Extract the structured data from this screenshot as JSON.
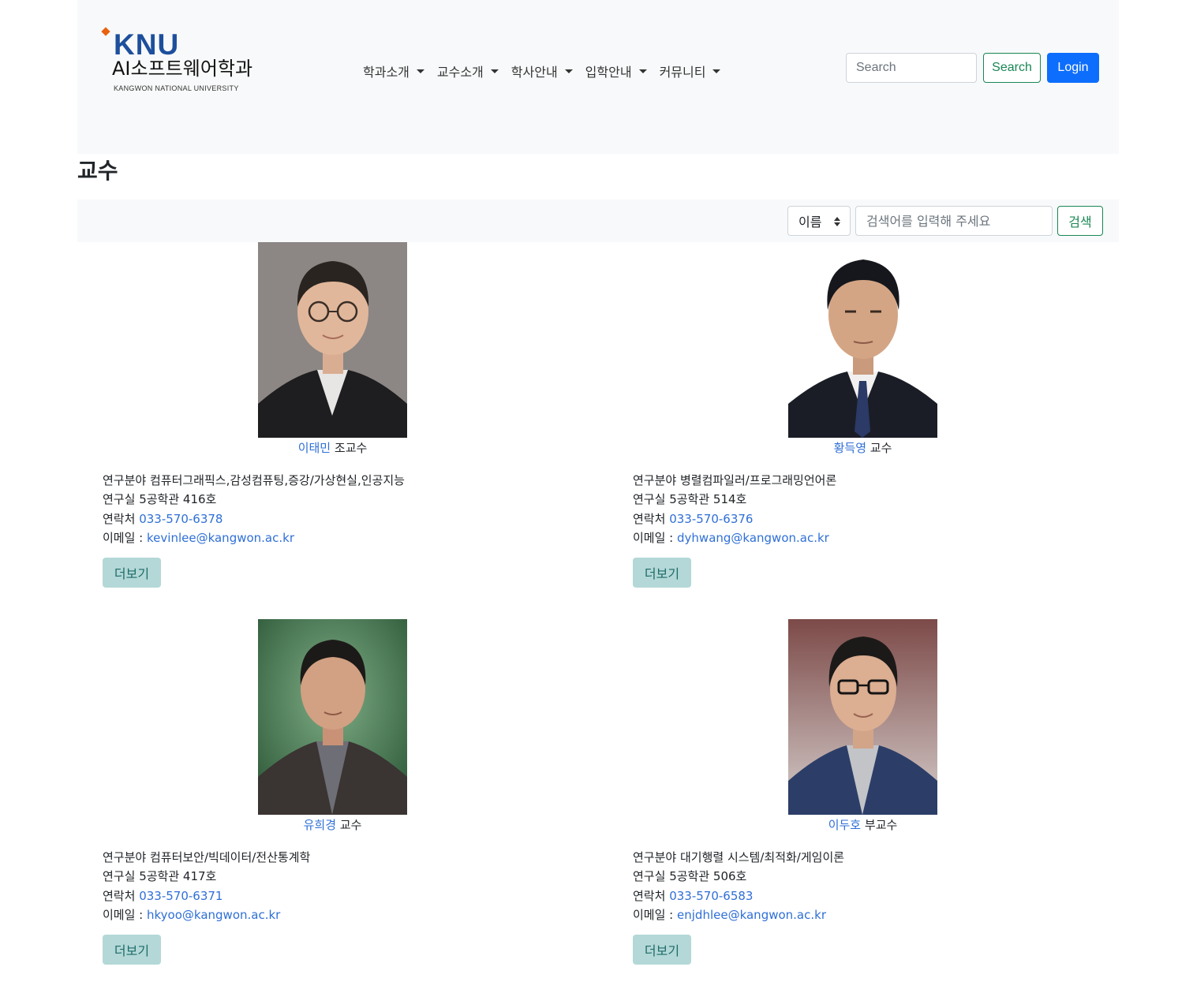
{
  "header": {
    "logo": {
      "brand": "KNU",
      "dept": "AI소프트웨어학과",
      "univ": "KANGWON NATIONAL UNIVERSITY",
      "brand_color": "#1d4f9c",
      "accent_color": "#e8620f"
    },
    "nav": [
      "학과소개",
      "교수소개",
      "학사안내",
      "입학안내",
      "커뮤니티"
    ],
    "search_placeholder": "Search",
    "search_button": "Search",
    "login_button": "Login"
  },
  "page": {
    "title": "교수"
  },
  "filter": {
    "select_value": "이름",
    "input_placeholder": "검색어를 입력해 주세요",
    "button": "검색"
  },
  "labels": {
    "field": "연구분야",
    "office": "연구실",
    "contact": "연락처",
    "email": "이메일 :",
    "more": "더보기"
  },
  "professors": [
    {
      "name": "이태민",
      "rank": "조교수",
      "field": "컴퓨터그래픽스,감성컴퓨팅,증강/가상현실,인공지능",
      "office": "5공학관 416호",
      "phone": "033-570-6378",
      "email": "kevinlee@kangwon.ac.kr",
      "photo_bg": "#8c8784"
    },
    {
      "name": "황득영",
      "rank": "교수",
      "field": "병렬컴파일러/프로그래밍언어론",
      "office": "5공학관 514호",
      "phone": "033-570-6376",
      "email": "dyhwang@kangwon.ac.kr",
      "photo_bg": "#ffffff"
    },
    {
      "name": "유희경",
      "rank": "교수",
      "field": "컴퓨터보안/빅데이터/전산통계학",
      "office": "5공학관 417호",
      "phone": "033-570-6371",
      "email": "hkyoo@kangwon.ac.kr",
      "photo_bg": "#4a7a52"
    },
    {
      "name": "이두호",
      "rank": "부교수",
      "field": "대기행렬 시스템/최적화/게임이론",
      "office": "5공학관 506호",
      "phone": "033-570-6583",
      "email": "enjdhlee@kangwon.ac.kr",
      "photo_bg": "#8a5a58"
    }
  ]
}
